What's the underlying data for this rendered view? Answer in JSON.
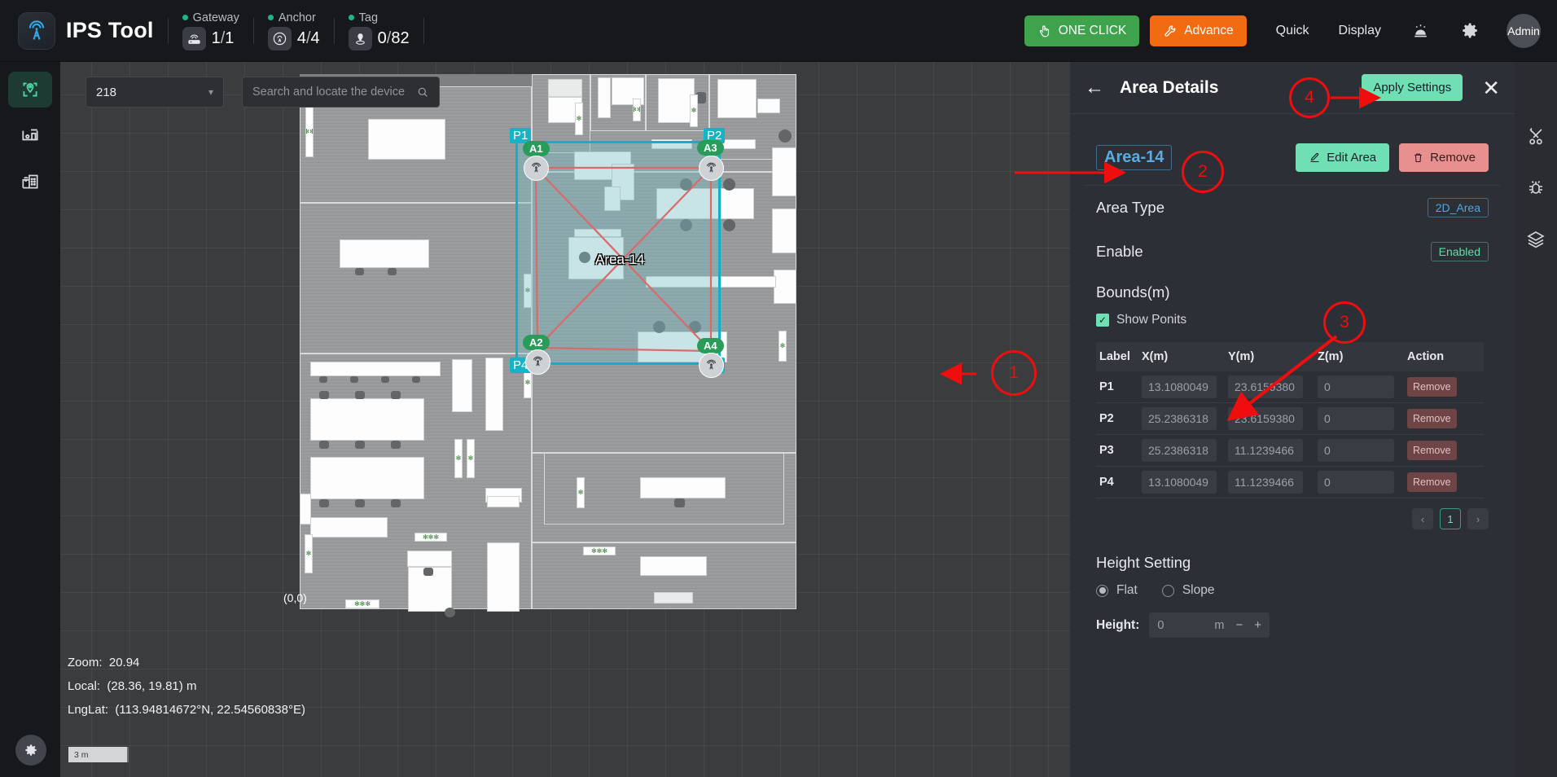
{
  "header": {
    "brand": "IPS Tool",
    "logo_icon": "antenna-tower-icon",
    "stats": [
      {
        "label": "Gateway",
        "icon": "router-icon",
        "value": "1",
        "sep": "/",
        "total": "1"
      },
      {
        "label": "Anchor",
        "icon": "anchor-signal-icon",
        "value": "4",
        "sep": "/",
        "total": "4"
      },
      {
        "label": "Tag",
        "icon": "tag-pin-icon",
        "value": "0",
        "sep": "/",
        "total": "82"
      }
    ],
    "one_click_label": "ONE CLICK",
    "one_click_icon": "click-hand-icon",
    "one_click_color": "#3fa34d",
    "advance_label": "Advance",
    "advance_icon": "wrench-icon",
    "advance_color": "#f36b10",
    "quick_label": "Quick",
    "display_label": "Display",
    "alarm_icon": "alarm-bell-icon",
    "settings_icon": "gear-icon",
    "user_label": "Admin"
  },
  "left_rail": {
    "items": [
      {
        "icon": "location-pin-map-icon",
        "active": true
      },
      {
        "icon": "device-dashboard-icon",
        "active": false
      },
      {
        "icon": "building-wifi-icon",
        "active": false
      }
    ],
    "bottom_icon": "gear-icon"
  },
  "map": {
    "floor_selected": "218",
    "floor_chevron": "chevron-down-icon",
    "search_placeholder": "Search and locate the device",
    "search_value": "",
    "search_icon": "search-icon",
    "zoom_label": "Zoom:",
    "zoom_value": "20.94",
    "local_label": "Local:",
    "local_value": "(28.36, 19.81) m",
    "lnglat_label": "LngLat:",
    "lnglat_value": "(113.94814672°N, 22.54560838°E)",
    "origin_label": "(0,0)",
    "scalebar_label": "3 m",
    "area_name": "Area-14",
    "point_labels": {
      "p1": "P1",
      "p2": "P2",
      "p3": "P3",
      "p4": "P4"
    },
    "anchors": [
      {
        "label": "A1"
      },
      {
        "label": "A2"
      },
      {
        "label": "A3"
      },
      {
        "label": "A4"
      }
    ],
    "area_fill_color": "#78bec3",
    "area_border_color": "#12b0c4",
    "link_color": "#d96a6a"
  },
  "panel": {
    "back_icon": "arrow-left-icon",
    "title": "Area Details",
    "apply_label": "Apply Settings",
    "close_icon": "close-icon",
    "area_chip": "Area-14",
    "edit_label": "Edit Area",
    "edit_icon": "pencil-icon",
    "remove_label": "Remove",
    "remove_icon": "trash-icon",
    "area_type_label": "Area Type",
    "area_type_value": "2D_Area",
    "enable_label": "Enable",
    "enable_value": "Enabled",
    "bounds_title": "Bounds(m)",
    "show_points_label": "Show Ponits",
    "show_points_checked": true,
    "bounds_columns": [
      "Label",
      "X(m)",
      "Y(m)",
      "Z(m)",
      "Action"
    ],
    "bounds_rows": [
      {
        "label": "P1",
        "x": "13.1080049",
        "y": "23.6159380",
        "z": "0",
        "action": "Remove"
      },
      {
        "label": "P2",
        "x": "25.2386318",
        "y": "23.6159380",
        "z": "0",
        "action": "Remove"
      },
      {
        "label": "P3",
        "x": "25.2386318",
        "y": "11.1239466",
        "z": "0",
        "action": "Remove"
      },
      {
        "label": "P4",
        "x": "13.1080049",
        "y": "11.1239466",
        "z": "0",
        "action": "Remove"
      }
    ],
    "pager": {
      "prev": "‹",
      "current": "1",
      "next": "›"
    },
    "height_title": "Height Setting",
    "flat_label": "Flat",
    "slope_label": "Slope",
    "height_mode": "Flat",
    "height_key": "Height:",
    "height_value": "0",
    "height_unit": "m",
    "minus": "−",
    "plus": "+"
  },
  "right_rail": {
    "items": [
      {
        "icon": "tools-cross-icon"
      },
      {
        "icon": "bug-icon"
      },
      {
        "icon": "layers-icon"
      }
    ]
  },
  "annotations": {
    "color": "#ef0d0d",
    "markers": [
      {
        "id": "1",
        "note": "points at area polygon on map"
      },
      {
        "id": "2",
        "note": "points at Edit Area button"
      },
      {
        "id": "3",
        "note": "points at bounds table"
      },
      {
        "id": "4",
        "note": "points at Apply Settings button"
      }
    ]
  }
}
